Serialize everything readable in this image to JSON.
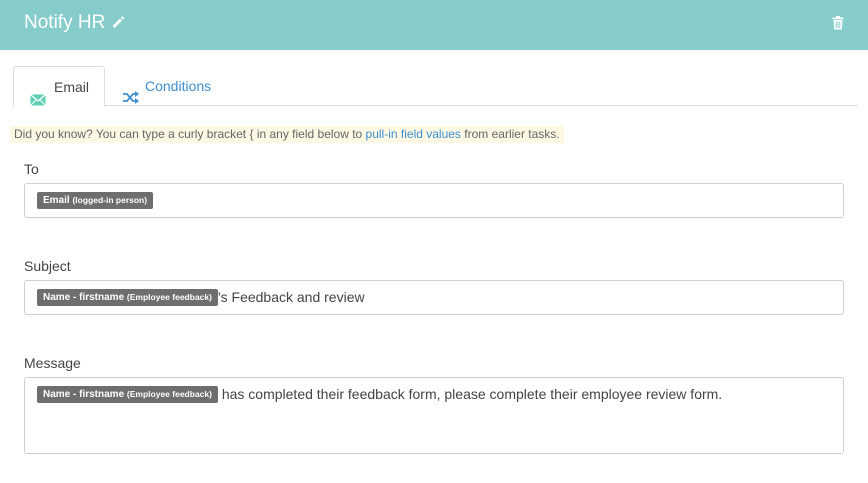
{
  "header": {
    "title": "Notify HR"
  },
  "tabs": [
    {
      "label": "Email",
      "icon": "envelope-icon",
      "active": true
    },
    {
      "label": "Conditions",
      "icon": "shuffle-icon",
      "active": false
    }
  ],
  "hint": {
    "prefix": "Did you know? You can type a curly bracket { in any field below to ",
    "link": "pull-in field values",
    "suffix": " from earlier tasks."
  },
  "fields": {
    "to": {
      "label": "To",
      "token": {
        "main": "Email",
        "sub": "(logged-in person)"
      },
      "text": ""
    },
    "subject": {
      "label": "Subject",
      "token": {
        "main": "Name - firstname",
        "sub": "(Employee feedback)"
      },
      "text": "'s Feedback and review"
    },
    "message": {
      "label": "Message",
      "token": {
        "main": "Name - firstname",
        "sub": "(Employee feedback)"
      },
      "text": " has completed their feedback form, please complete their employee review form."
    }
  },
  "colors": {
    "header": "#86cccb",
    "link": "#3d8fd1",
    "token": "#6e6e6e",
    "hint_bg": "#fcf8e3",
    "email_icon": "#5fcfb6"
  }
}
